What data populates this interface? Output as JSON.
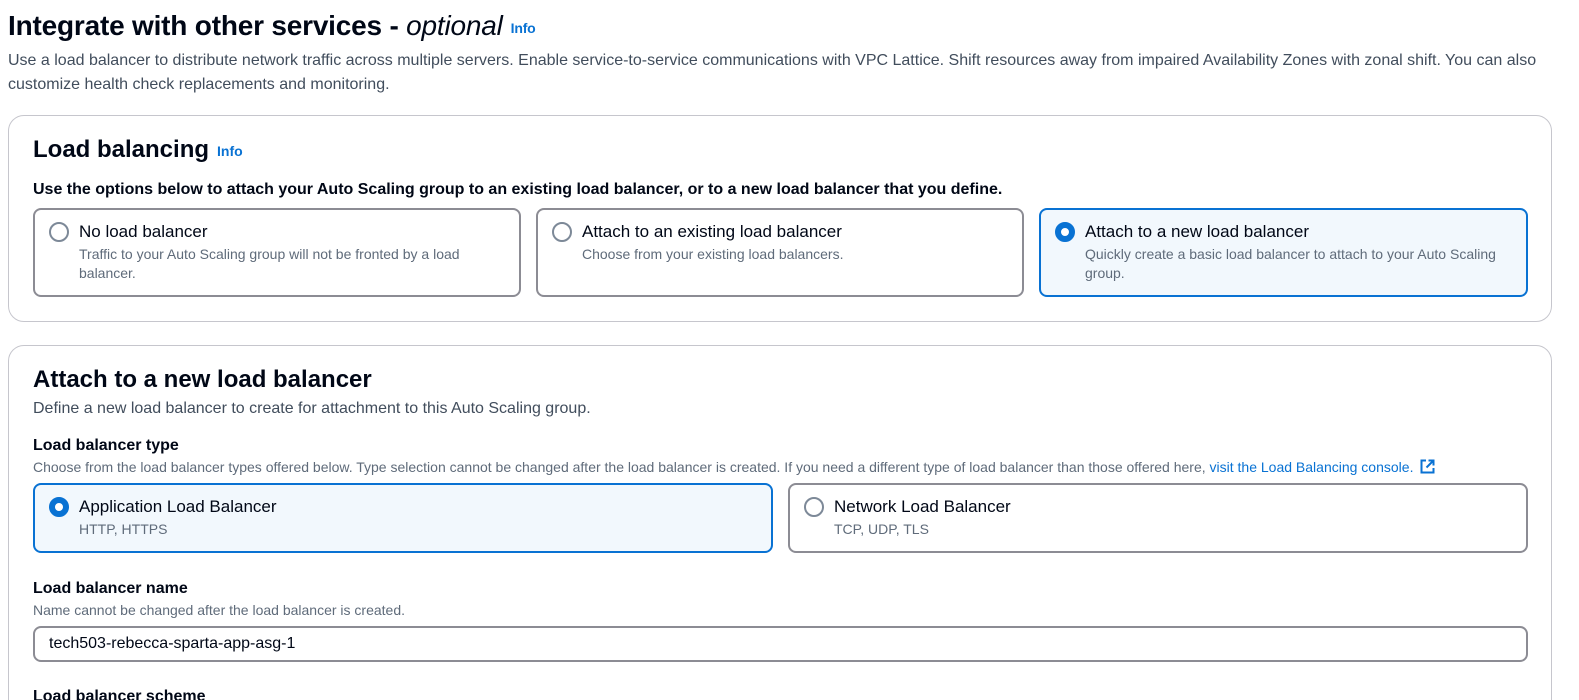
{
  "section": {
    "title_main": "Integrate with other services - ",
    "title_optional": "optional",
    "info": "Info",
    "description": "Use a load balancer to distribute network traffic across multiple servers. Enable service-to-service communications with VPC Lattice. Shift resources away from impaired Availability Zones with zonal shift. You can also customize health check replacements and monitoring."
  },
  "load_balancing": {
    "title": "Load balancing",
    "info": "Info",
    "instruction": "Use the options below to attach your Auto Scaling group to an existing load balancer, or to a new load balancer that you define.",
    "options": [
      {
        "label": "No load balancer",
        "description": "Traffic to your Auto Scaling group will not be fronted by a load balancer.",
        "selected": false
      },
      {
        "label": "Attach to an existing load balancer",
        "description": "Choose from your existing load balancers.",
        "selected": false
      },
      {
        "label": "Attach to a new load balancer",
        "description": "Quickly create a basic load balancer to attach to your Auto Scaling group.",
        "selected": true
      }
    ]
  },
  "new_lb": {
    "title": "Attach to a new load balancer",
    "description": "Define a new load balancer to create for attachment to this Auto Scaling group.",
    "type_label": "Load balancer type",
    "type_description": "Choose from the load balancer types offered below. Type selection cannot be changed after the load balancer is created. If you need a different type of load balancer than those offered here, ",
    "type_link": "visit the Load Balancing console.",
    "types": [
      {
        "label": "Application Load Balancer",
        "description": "HTTP, HTTPS",
        "selected": true
      },
      {
        "label": "Network Load Balancer",
        "description": "TCP, UDP, TLS",
        "selected": false
      }
    ],
    "name_label": "Load balancer name",
    "name_description": "Name cannot be changed after the load balancer is created.",
    "name_value": "tech503-rebecca-sparta-app-asg-1",
    "next_label_partial": "Load balancer scheme"
  },
  "colors": {
    "accent": "#0972d3",
    "selected_bg": "#f2f8fd",
    "border": "#8c8c94"
  }
}
